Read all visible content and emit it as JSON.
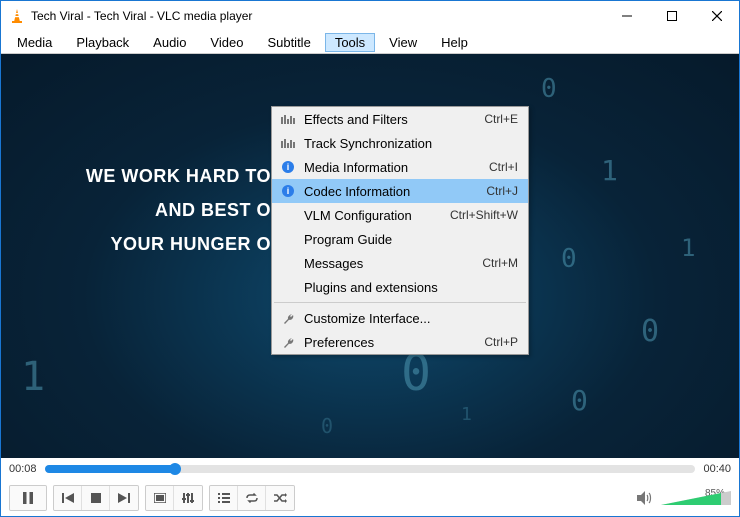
{
  "window": {
    "title": "Tech Viral - Tech Viral - VLC media player"
  },
  "menubar": {
    "items": [
      "Media",
      "Playback",
      "Audio",
      "Video",
      "Subtitle",
      "Tools",
      "View",
      "Help"
    ],
    "active_index": 5
  },
  "tools_menu": {
    "items": [
      {
        "icon": "equalizer",
        "label": "Effects and Filters",
        "shortcut": "Ctrl+E"
      },
      {
        "icon": "equalizer",
        "label": "Track Synchronization",
        "shortcut": ""
      },
      {
        "icon": "info",
        "label": "Media Information",
        "shortcut": "Ctrl+I"
      },
      {
        "icon": "info",
        "label": "Codec Information",
        "shortcut": "Ctrl+J",
        "selected": true
      },
      {
        "icon": "",
        "label": "VLM Configuration",
        "shortcut": "Ctrl+Shift+W"
      },
      {
        "icon": "",
        "label": "Program Guide",
        "shortcut": ""
      },
      {
        "icon": "",
        "label": "Messages",
        "shortcut": "Ctrl+M"
      },
      {
        "icon": "",
        "label": "Plugins and extensions",
        "shortcut": ""
      },
      {
        "sep": true
      },
      {
        "icon": "wrench",
        "label": "Customize Interface...",
        "shortcut": ""
      },
      {
        "icon": "wrench",
        "label": "Preferences",
        "shortcut": "Ctrl+P"
      }
    ]
  },
  "video": {
    "overlay_lines": [
      "WE WORK HARD TO",
      "AND BEST O",
      "YOUR HUNGER O"
    ]
  },
  "time": {
    "elapsed": "00:08",
    "total": "00:40",
    "progress_pct": 20
  },
  "volume": {
    "pct_label": "85%"
  }
}
